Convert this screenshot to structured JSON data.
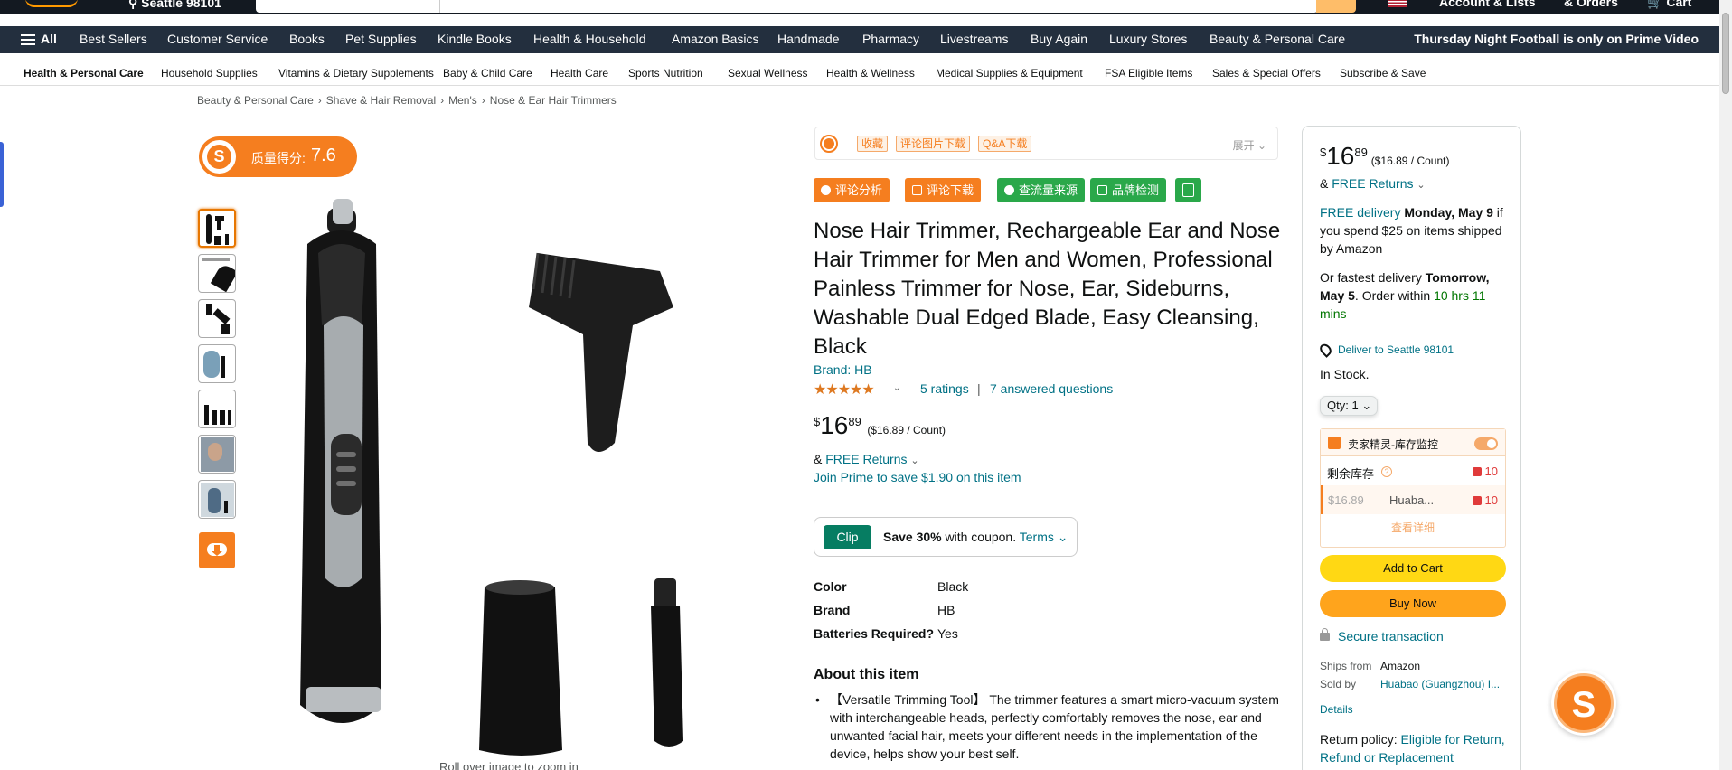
{
  "header": {
    "deliver": "Seattle 98101",
    "account": "Account & Lists",
    "orders": "& Orders",
    "cart": "Cart"
  },
  "nav": {
    "all": "All",
    "items": [
      "Best Sellers",
      "Customer Service",
      "Books",
      "Pet Supplies",
      "Kindle Books",
      "Health & Household",
      "Amazon Basics",
      "Handmade",
      "Pharmacy",
      "Livestreams",
      "Buy Again",
      "Luxury Stores",
      "Beauty & Personal Care"
    ],
    "promo": "Thursday Night Football is only on Prime Video"
  },
  "subnav": [
    "Health & Personal Care",
    "Household Supplies",
    "Vitamins & Dietary Supplements",
    "Baby & Child Care",
    "Health Care",
    "Sports Nutrition",
    "Sexual Wellness",
    "Health & Wellness",
    "Medical Supplies & Equipment",
    "FSA Eligible Items",
    "Sales & Special Offers",
    "Subscribe & Save"
  ],
  "breadcrumb": [
    "Beauty & Personal Care",
    "Shave & Hair Removal",
    "Men's",
    "Nose & Ear Hair Trimmers"
  ],
  "quality": {
    "label": "质量得分:",
    "score": "7.6"
  },
  "plugin": {
    "tags": [
      "收藏",
      "评论图片下载",
      "Q&A下载"
    ],
    "expand": "展开",
    "buttons": [
      "评论分析",
      "评论下载",
      "查流量来源",
      "品牌检测"
    ]
  },
  "product": {
    "title": "Nose Hair Trimmer, Rechargeable Ear and Nose Hair Trimmer for Men and Women, Professional Painless Trimmer for Nose, Ear, Sideburns, Washable Dual Edged Blade, Easy Cleansing, Black",
    "brand": "Brand: HB",
    "stars": "★★★★★",
    "ratings": "5 ratings",
    "answered": "7 answered questions",
    "price_currency": "$",
    "price_whole": "16",
    "price_fraction": "89",
    "price_unit": "($16.89 / Count)",
    "returns_prefix": "& ",
    "returns": "FREE Returns",
    "prime": "Join Prime to save $1.90 on this item",
    "coupon_clip": "Clip",
    "coupon_save": "Save 30%",
    "coupon_with": " with coupon. ",
    "coupon_terms": "Terms",
    "specs": [
      {
        "k": "Color",
        "v": "Black"
      },
      {
        "k": "Brand",
        "v": "HB"
      },
      {
        "k": "Batteries Required?",
        "v": "Yes"
      }
    ],
    "about": "About this item",
    "bullet1": "【Versatile Trimming Tool】 The trimmer features a smart micro-vacuum system with interchangeable heads, perfectly comfortably removes the nose, ear and unwanted facial hair, meets your different needs in the implementation of the device, helps show your best self.",
    "rollover": "Roll over image to zoom in"
  },
  "buybox": {
    "price_currency": "$",
    "price_whole": "16",
    "price_fraction": "89",
    "price_unit": "($16.89 / Count)",
    "returns_prefix": "& ",
    "returns": "FREE Returns",
    "free_delivery": "FREE delivery",
    "delivery_date": "Monday, May 9",
    "delivery_rest": " if you spend $25 on items shipped by Amazon",
    "fastest_prefix": "Or fastest delivery ",
    "fastest_date": "Tomorrow, May 5",
    "order_within": ". Order within ",
    "order_time": "10 hrs 11 mins",
    "deliver_to": "Deliver to Seattle 98101",
    "in_stock": "In Stock.",
    "qty": "Qty: 1",
    "stock_title": "卖家精灵-库存监控",
    "stock_label": "剩余库存",
    "stock_total": "10",
    "seller_price": "$16.89",
    "seller_name": "Huaba...",
    "seller_stock": "10",
    "more": "查看详细",
    "add_to_cart": "Add to Cart",
    "buy_now": "Buy Now",
    "secure": "Secure transaction",
    "ships_from_label": "Ships from",
    "ships_from": "Amazon",
    "sold_by_label": "Sold by",
    "sold_by": "Huabao (Guangzhou) I...",
    "details": "Details",
    "return_policy_label": "Return policy: ",
    "return_policy": "Eligible for Return, Refund or Replacement"
  }
}
